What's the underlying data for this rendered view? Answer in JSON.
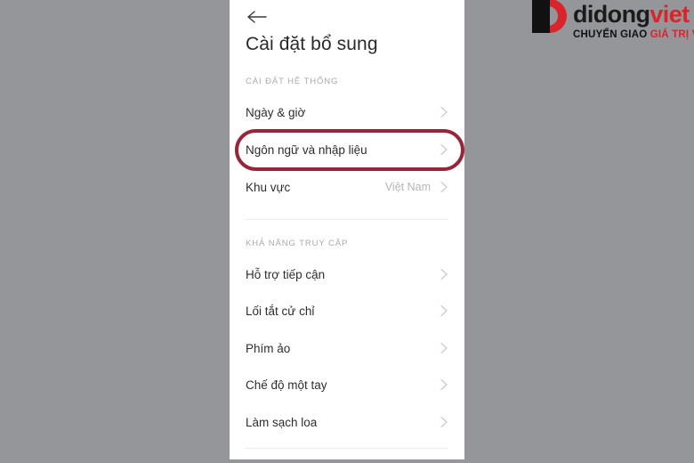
{
  "brand": {
    "mark_icon": "didongviet-d-mark-icon",
    "wordmark_part1": "didong",
    "wordmark_part2": "viet",
    "tagline_part1": "CHUYỂN GIAO",
    "tagline_part2": "GIÁ TRỊ VƯỢT TRỘI",
    "color_red": "#d8242a",
    "color_black": "#1b1b1b"
  },
  "screen": {
    "back_icon": "back-arrow-icon",
    "title": "Cài đặt bổ sung",
    "background": "#ffffff"
  },
  "sections": [
    {
      "header": "CÀI ĐẶT HỆ THỐNG",
      "items": [
        {
          "label": "Ngày & giờ",
          "value": "",
          "chevron": "chevron-right-icon"
        },
        {
          "label": "Ngôn ngữ và nhập liệu",
          "value": "",
          "chevron": "chevron-right-icon"
        },
        {
          "label": "Khu vực",
          "value": "Việt Nam",
          "chevron": "chevron-right-icon"
        }
      ]
    },
    {
      "header": "KHẢ NĂNG TRUY CẬP",
      "items": [
        {
          "label": "Hỗ trợ tiếp cận",
          "value": "",
          "chevron": "chevron-right-icon"
        },
        {
          "label": "Lối tắt cử chỉ",
          "value": "",
          "chevron": "chevron-right-icon"
        },
        {
          "label": "Phím ảo",
          "value": "",
          "chevron": "chevron-right-icon"
        },
        {
          "label": "Chế độ một tay",
          "value": "",
          "chevron": "chevron-right-icon"
        },
        {
          "label": "Làm sạch loa",
          "value": "",
          "chevron": "chevron-right-icon"
        }
      ]
    }
  ],
  "annotation": {
    "target_label": "Ngôn ngữ và nhập liệu",
    "shape": "oval",
    "color": "#98263a"
  }
}
